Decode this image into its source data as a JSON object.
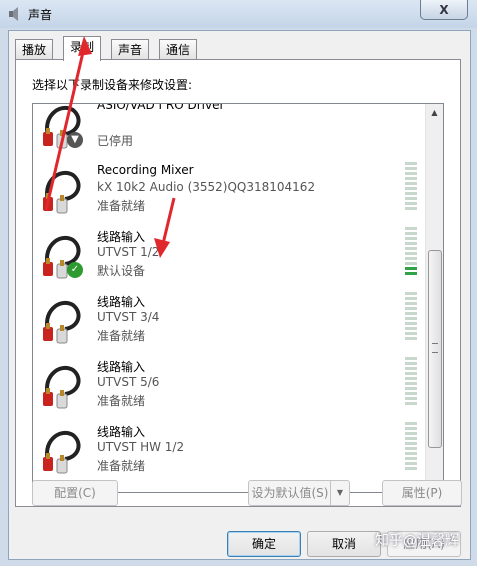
{
  "window": {
    "title": "声音",
    "close_glyph": "X"
  },
  "tabs": [
    {
      "label": "播放"
    },
    {
      "label": "录制"
    },
    {
      "label": "声音"
    },
    {
      "label": "通信"
    }
  ],
  "instruction": "选择以下录制设备来修改设置:",
  "devices": [
    {
      "name": "ASIO/VAD I RO Driver",
      "detail": "",
      "status": "已停用",
      "badge": "down",
      "level": 0
    },
    {
      "name": "Recording Mixer",
      "detail": "kX 10k2 Audio (3552)QQ318104162",
      "status": "准备就绪",
      "badge": "",
      "level": 0
    },
    {
      "name": "线路输入",
      "detail": "UTVST 1/2",
      "status": "默认设备",
      "badge": "check",
      "level": 0.2
    },
    {
      "name": "线路输入",
      "detail": "UTVST 3/4",
      "status": "准备就绪",
      "badge": "",
      "level": 0
    },
    {
      "name": "线路输入",
      "detail": "UTVST 5/6",
      "status": "准备就绪",
      "badge": "",
      "level": 0
    },
    {
      "name": "线路输入",
      "detail": "UTVST HW 1/2",
      "status": "准备就绪",
      "badge": "",
      "level": 0
    }
  ],
  "buttons": {
    "configure": "配置(C)",
    "set_default": "设为默认值(S)",
    "properties": "属性(P)",
    "ok": "确定",
    "cancel": "取消",
    "apply": "应用(A)"
  },
  "watermark": "知乎@温馨辉",
  "colors": {
    "accent": "#3c7fb1",
    "annotation_arrow": "#e0282c",
    "meter_active": "#2fa24a"
  }
}
